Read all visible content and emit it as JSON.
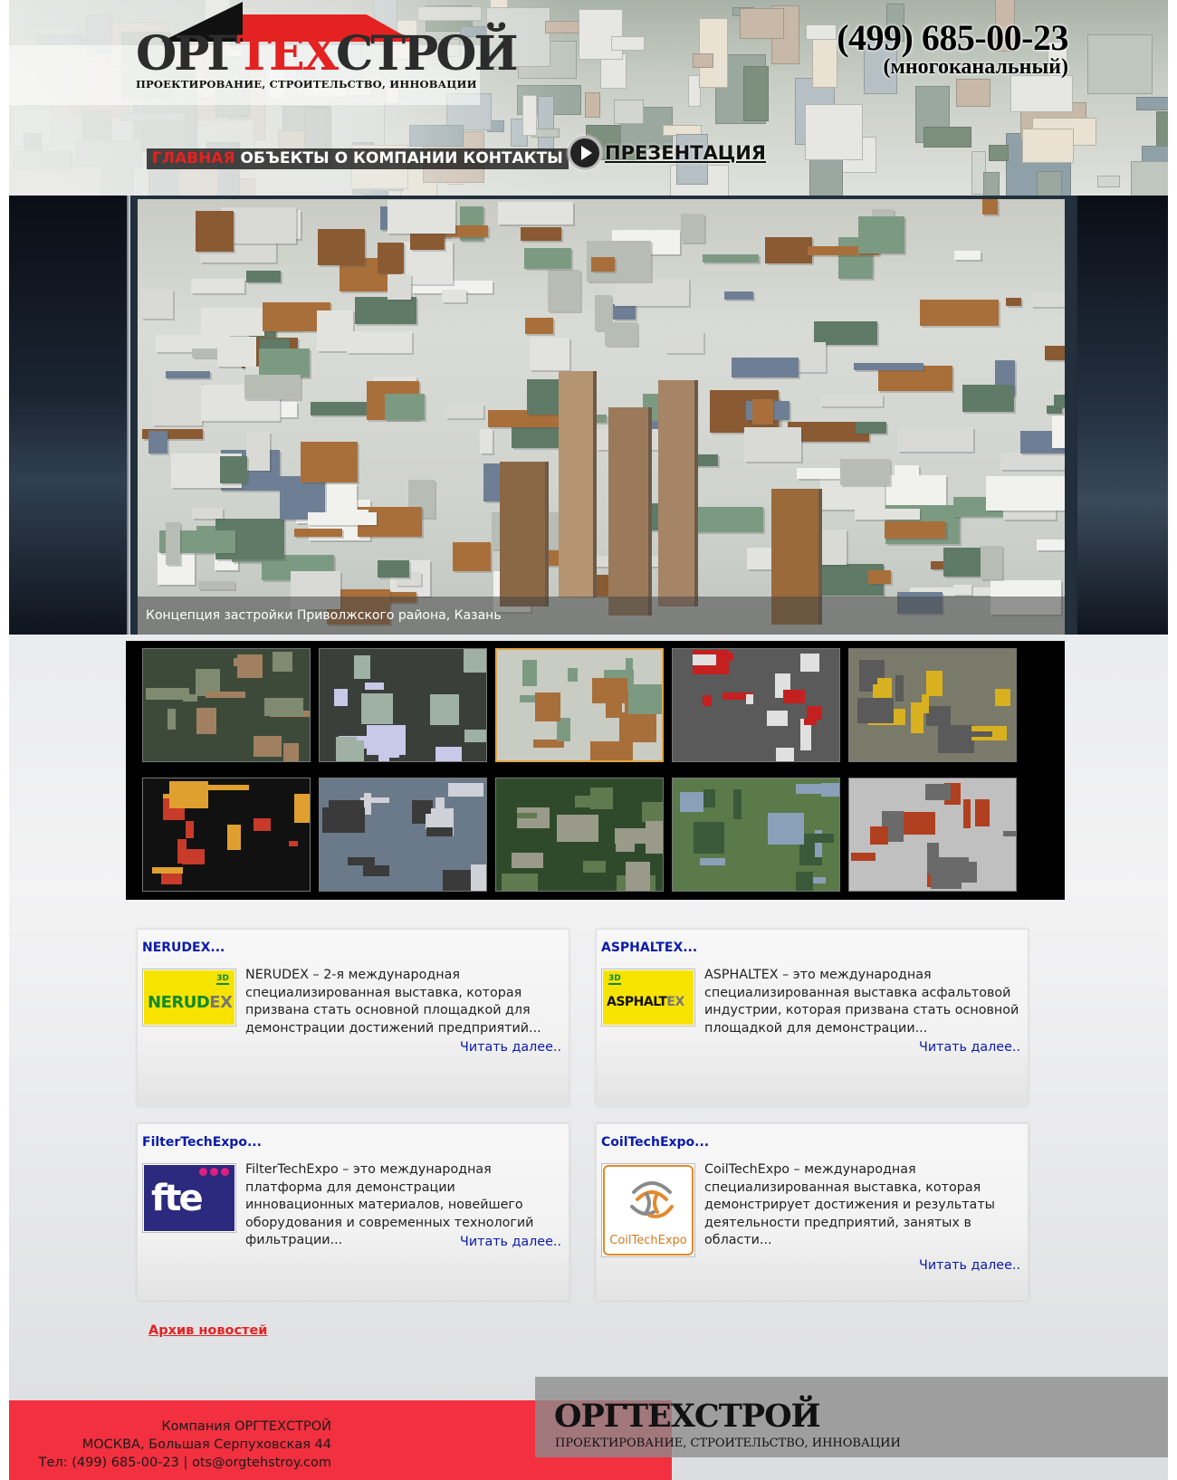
{
  "header": {
    "logo": {
      "title_part1": "ОРГ",
      "title_part2": "ТЕХ",
      "title_part3": "СТРОЙ",
      "tagline": "ПРОЕКТИРОВАНИЕ, СТРОИТЕЛЬСТВО, ИННОВАЦИИ"
    },
    "phone": {
      "number": "(499) 685-00-23",
      "note": "(многоканальный)"
    },
    "nav": [
      {
        "label": "ГЛАВНАЯ",
        "active": true
      },
      {
        "label": "ОБЪЕКТЫ",
        "active": false
      },
      {
        "label": "О КОМПАНИИ",
        "active": false
      },
      {
        "label": "КОНТАКТЫ",
        "active": false
      }
    ],
    "presentation_label": "ПРЕЗЕНТАЦИЯ"
  },
  "slider": {
    "caption": "Концепция застройки Приволжского района, Казань",
    "active_thumb_index": 2,
    "thumb_count": 10
  },
  "news": [
    {
      "title": "NERUDEX...",
      "logo_icon": "nerudex-logo",
      "logo_text_a": "NERUD",
      "logo_text_b": "EX",
      "badge": "3D",
      "text": "NERUDEX – 2-я международная специализированная выставка, которая призвана стать основной площадкой для демонстрации достижений предприятий...",
      "more": "Читать далее.."
    },
    {
      "title": "ASPHALTEX...",
      "logo_icon": "asphaltex-logo",
      "logo_text_a": "ASPHALT",
      "logo_text_b": "EX",
      "badge": "3D",
      "text": "ASPHALTEX – это международная специализированная выставка асфальтовой индустрии, которая призвана стать основной площадкой для демонстрации...",
      "more": "Читать далее.."
    },
    {
      "title": "FilterTechExpo...",
      "logo_icon": "fte-logo",
      "logo_text_a": "fte",
      "text": "FilterTechExpo – это международная платформа для демонстрации инновационных материалов, новейшего оборудования и современных технологий фильтрации...",
      "more": "Читать далее.."
    },
    {
      "title": "CoilTechExpo...",
      "logo_icon": "coiltechexpo-logo",
      "logo_text_a": "CoilTechExpo",
      "text": "CoilTechExpo – международная специализированная выставка, которая демонстрирует достижения и результаты деятельности предприятий, занятых в области...",
      "more": "Читать далее.."
    }
  ],
  "archive_link": "Архив новостей",
  "footer": {
    "company": "Компания ОРГТЕХСТРОЙ",
    "address": "МОСКВА, Большая Серпуховская 44",
    "contacts": "Тел: (499) 685-00-23 | ots@orgtehstroy.com",
    "brand": "ОРГТЕХСТРОЙ",
    "tagline": "ПРОЕКТИРОВАНИЕ, СТРОИТЕЛЬСТВО, ИННОВАЦИИ"
  },
  "colors": {
    "accent_red": "#e42221",
    "link_blue": "#0a1aaa",
    "footer_red": "#f2303f",
    "thumb_active": "#e0a44a"
  }
}
